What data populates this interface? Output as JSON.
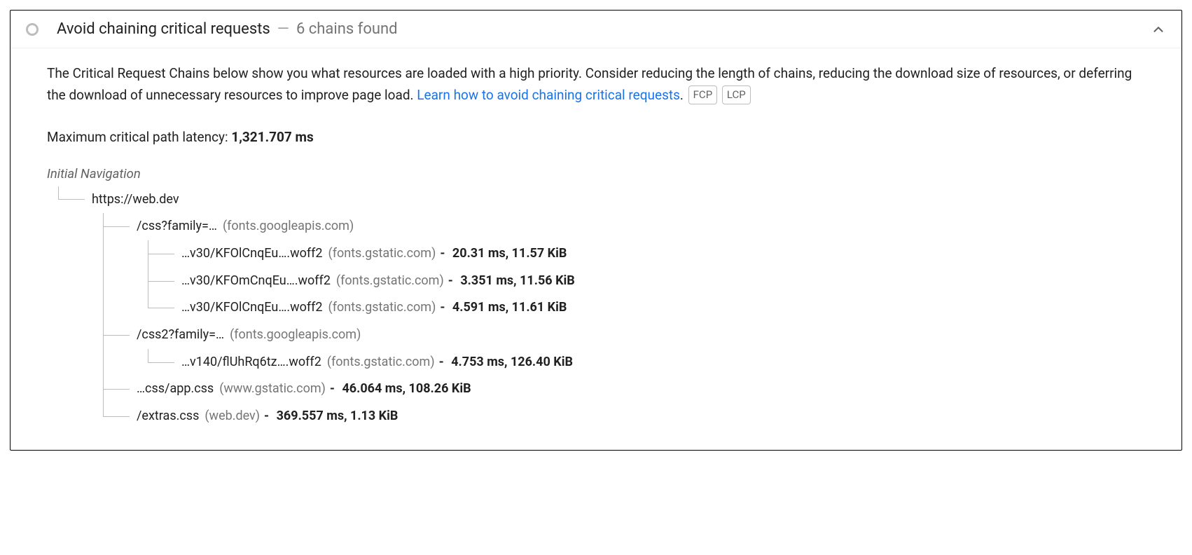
{
  "header": {
    "title": "Avoid chaining critical requests",
    "separator": "—",
    "subtitle": "6 chains found"
  },
  "description": {
    "text1": "The Critical Request Chains below show you what resources are loaded with a high priority. Consider reducing the length of chains, reducing the download size of resources, or deferring the download of unnecessary resources to improve page load. ",
    "link_text": "Learn how to avoid chaining critical requests",
    "text2": ".",
    "tags": [
      "FCP",
      "LCP"
    ]
  },
  "max_latency": {
    "label": "Maximum critical path latency: ",
    "value": "1,321.707 ms"
  },
  "tree": {
    "root_label": "Initial Navigation",
    "root": {
      "path": "https://web.dev",
      "host": "",
      "stats": "",
      "children": [
        {
          "path": "/css?family=…",
          "host": "(fonts.googleapis.com)",
          "stats": "",
          "children": [
            {
              "path": "…v30/KFOlCnqEu….woff2",
              "host": "(fonts.gstatic.com)",
              "stats": "20.31 ms, 11.57 KiB"
            },
            {
              "path": "…v30/KFOmCnqEu….woff2",
              "host": "(fonts.gstatic.com)",
              "stats": "3.351 ms, 11.56 KiB"
            },
            {
              "path": "…v30/KFOlCnqEu….woff2",
              "host": "(fonts.gstatic.com)",
              "stats": "4.591 ms, 11.61 KiB"
            }
          ]
        },
        {
          "path": "/css2?family=…",
          "host": "(fonts.googleapis.com)",
          "stats": "",
          "children": [
            {
              "path": "…v140/flUhRq6tz….woff2",
              "host": "(fonts.gstatic.com)",
              "stats": "4.753 ms, 126.40 KiB"
            }
          ]
        },
        {
          "path": "…css/app.css",
          "host": "(www.gstatic.com)",
          "stats": "46.064 ms, 108.26 KiB"
        },
        {
          "path": "/extras.css",
          "host": "(web.dev)",
          "stats": "369.557 ms, 1.13 KiB"
        }
      ]
    }
  }
}
